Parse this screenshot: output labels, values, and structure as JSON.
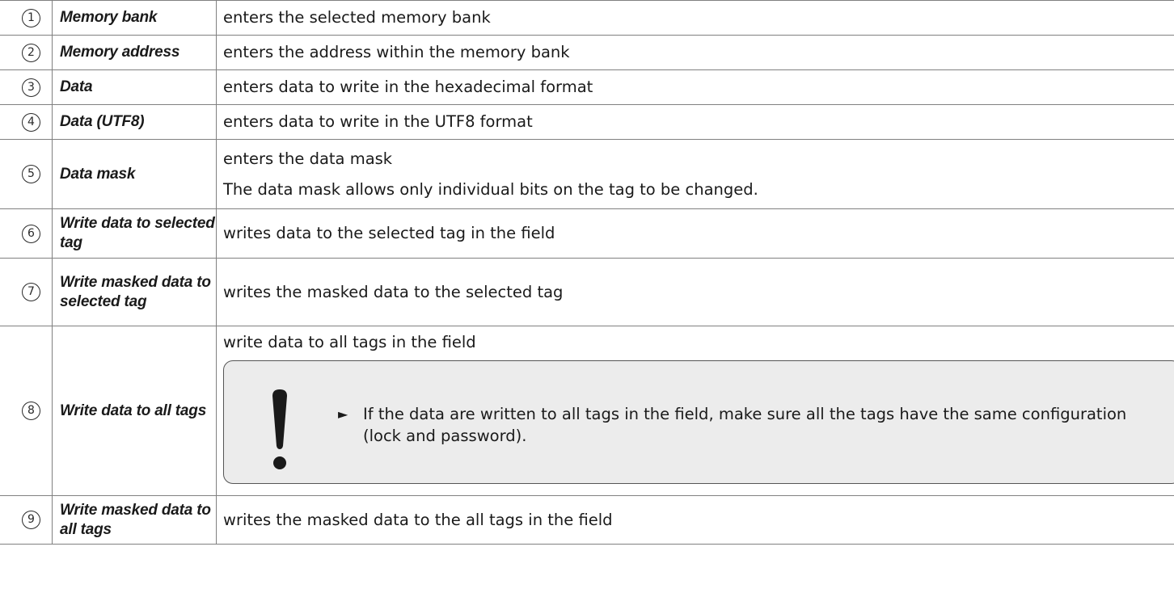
{
  "rows": [
    {
      "num": "1",
      "key": "Memory bank",
      "desc": [
        "enters the selected memory bank"
      ]
    },
    {
      "num": "2",
      "key": "Memory address",
      "desc": [
        "enters the address within the memory bank"
      ]
    },
    {
      "num": "3",
      "key": "Data",
      "desc": [
        "enters data to write in the hexadecimal format"
      ]
    },
    {
      "num": "4",
      "key": "Data (UTF8)",
      "desc": [
        "enters data to write in the UTF8 format"
      ]
    },
    {
      "num": "5",
      "key": "Data mask",
      "desc": [
        "enters the data mask",
        "The data mask allows only individual bits on the tag to be changed."
      ]
    },
    {
      "num": "6",
      "key": "Write data to selected tag",
      "desc": [
        "writes data to the selected tag in the field"
      ]
    },
    {
      "num": "7",
      "key": "Write masked data to selected tag",
      "desc": [
        "writes the masked data to the selected tag"
      ]
    },
    {
      "num": "8",
      "key": "Write data to all tags",
      "desc": [
        "write data to all tags in the field"
      ],
      "note": "If the data are written to all tags in the field, make sure all the tags have the same configuration (lock and password)."
    },
    {
      "num": "9",
      "key": "Write masked data to all tags",
      "desc": [
        "writes the masked data to the all tags in the field"
      ]
    }
  ],
  "icons": {
    "note_icon": "exclamation-icon",
    "bullet_icon": "triangle-right-icon"
  }
}
